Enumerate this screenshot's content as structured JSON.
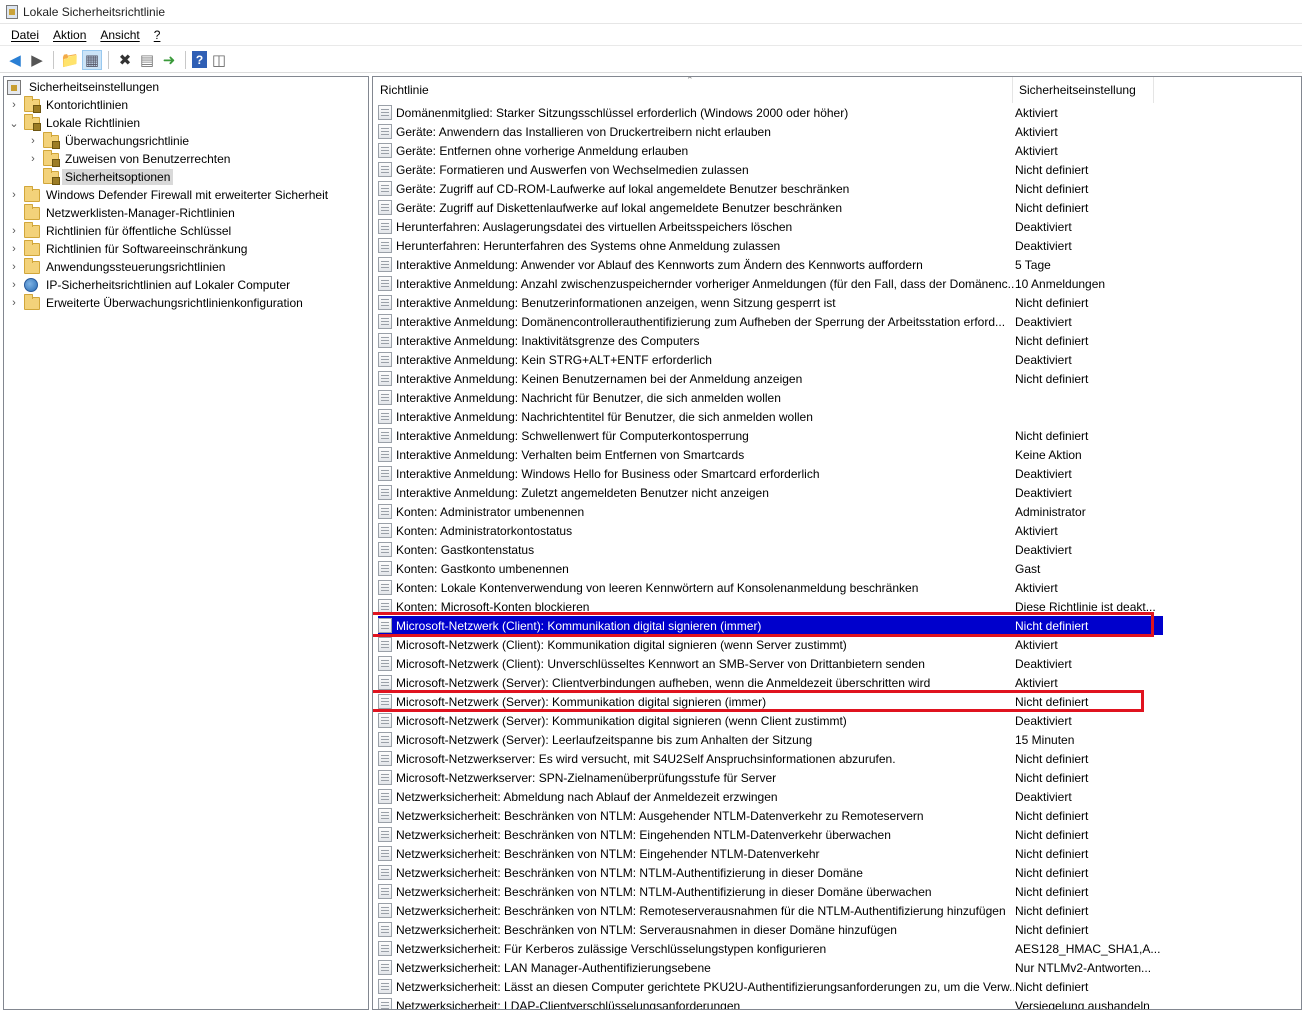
{
  "window": {
    "title": "Lokale Sicherheitsrichtlinie"
  },
  "menu": {
    "items": [
      "Datei",
      "Aktion",
      "Ansicht",
      "?"
    ]
  },
  "toolbar": {
    "buttons": [
      "back-arrow-icon",
      "forward-arrow-icon",
      "up-folder-icon",
      "show-hide-tree-icon",
      "delete-icon",
      "properties-icon",
      "export-list-icon",
      "help-icon",
      "action-pane-icon"
    ]
  },
  "tree": {
    "root": "Sicherheitseinstellungen",
    "items": [
      "Kontorichtlinien",
      "Lokale Richtlinien",
      "Überwachungsrichtlinie",
      "Zuweisen von Benutzerrechten",
      "Sicherheitsoptionen",
      "Windows Defender Firewall mit erweiterter Sicherheit",
      "Netzwerklisten-Manager-Richtlinien",
      "Richtlinien für öffentliche Schlüssel",
      "Richtlinien für Softwareeinschränkung",
      "Anwendungssteuerungsrichtlinien",
      "IP-Sicherheitsrichtlinien auf Lokaler Computer",
      "Erweiterte Überwachungsrichtlinienkonfiguration"
    ]
  },
  "list": {
    "columns": {
      "policy": "Richtlinie",
      "setting": "Sicherheitseinstellung"
    },
    "rows": [
      [
        "Domänenmitglied: Starker Sitzungsschlüssel erforderlich (Windows 2000 oder höher)",
        "Aktiviert"
      ],
      [
        "Geräte: Anwendern das Installieren von Druckertreibern nicht erlauben",
        "Aktiviert"
      ],
      [
        "Geräte: Entfernen ohne vorherige Anmeldung erlauben",
        "Aktiviert"
      ],
      [
        "Geräte: Formatieren und Auswerfen von Wechselmedien zulassen",
        "Nicht definiert"
      ],
      [
        "Geräte: Zugriff auf CD-ROM-Laufwerke auf lokal angemeldete Benutzer beschränken",
        "Nicht definiert"
      ],
      [
        "Geräte: Zugriff auf Diskettenlaufwerke auf lokal angemeldete Benutzer beschränken",
        "Nicht definiert"
      ],
      [
        "Herunterfahren: Auslagerungsdatei des virtuellen Arbeitsspeichers löschen",
        "Deaktiviert"
      ],
      [
        "Herunterfahren: Herunterfahren des Systems ohne Anmeldung zulassen",
        "Deaktiviert"
      ],
      [
        "Interaktive Anmeldung: Anwender vor Ablauf des Kennworts zum Ändern des Kennworts auffordern",
        "5 Tage"
      ],
      [
        "Interaktive Anmeldung: Anzahl zwischenzuspeichernder vorheriger Anmeldungen (für den Fall, dass der Domänenc...",
        "10 Anmeldungen"
      ],
      [
        "Interaktive Anmeldung: Benutzerinformationen anzeigen, wenn Sitzung gesperrt ist",
        "Nicht definiert"
      ],
      [
        "Interaktive Anmeldung: Domänencontrollerauthentifizierung zum Aufheben der Sperrung der Arbeitsstation erford...",
        "Deaktiviert"
      ],
      [
        "Interaktive Anmeldung: Inaktivitätsgrenze des Computers",
        "Nicht definiert"
      ],
      [
        "Interaktive Anmeldung: Kein STRG+ALT+ENTF erforderlich",
        "Deaktiviert"
      ],
      [
        "Interaktive Anmeldung: Keinen Benutzernamen bei der Anmeldung anzeigen",
        "Nicht definiert"
      ],
      [
        "Interaktive Anmeldung: Nachricht für Benutzer, die sich anmelden wollen",
        ""
      ],
      [
        "Interaktive Anmeldung: Nachrichtentitel für Benutzer, die sich anmelden wollen",
        ""
      ],
      [
        "Interaktive Anmeldung: Schwellenwert für Computerkontosperrung",
        "Nicht definiert"
      ],
      [
        "Interaktive Anmeldung: Verhalten beim Entfernen von Smartcards",
        "Keine Aktion"
      ],
      [
        "Interaktive Anmeldung: Windows Hello for Business oder Smartcard erforderlich",
        "Deaktiviert"
      ],
      [
        "Interaktive Anmeldung: Zuletzt angemeldeten Benutzer nicht anzeigen",
        "Deaktiviert"
      ],
      [
        "Konten: Administrator umbenennen",
        "Administrator"
      ],
      [
        "Konten: Administratorkontostatus",
        "Aktiviert"
      ],
      [
        "Konten: Gastkontenstatus",
        "Deaktiviert"
      ],
      [
        "Konten: Gastkonto umbenennen",
        "Gast"
      ],
      [
        "Konten: Lokale Kontenverwendung von leeren Kennwörtern auf Konsolenanmeldung beschränken",
        "Aktiviert"
      ],
      [
        "Konten: Microsoft-Konten blockieren",
        "Diese Richtlinie ist deakt..."
      ],
      [
        "Microsoft-Netzwerk (Client): Kommunikation digital signieren (immer)",
        "Nicht definiert"
      ],
      [
        "Microsoft-Netzwerk (Client): Kommunikation digital signieren (wenn Server zustimmt)",
        "Aktiviert"
      ],
      [
        "Microsoft-Netzwerk (Client): Unverschlüsseltes Kennwort an SMB-Server von Drittanbietern senden",
        "Deaktiviert"
      ],
      [
        "Microsoft-Netzwerk (Server): Clientverbindungen aufheben, wenn die Anmeldezeit überschritten wird",
        "Aktiviert"
      ],
      [
        "Microsoft-Netzwerk (Server): Kommunikation digital signieren (immer)",
        "Nicht definiert"
      ],
      [
        "Microsoft-Netzwerk (Server): Kommunikation digital signieren (wenn Client zustimmt)",
        "Deaktiviert"
      ],
      [
        "Microsoft-Netzwerk (Server): Leerlaufzeitspanne bis zum Anhalten der Sitzung",
        "15 Minuten"
      ],
      [
        "Microsoft-Netzwerkserver: Es wird versucht, mit S4U2Self Anspruchsinformationen abzurufen.",
        "Nicht definiert"
      ],
      [
        "Microsoft-Netzwerkserver: SPN-Zielnamenüberprüfungsstufe für Server",
        "Nicht definiert"
      ],
      [
        "Netzwerksicherheit: Abmeldung nach Ablauf der Anmeldezeit erzwingen",
        "Deaktiviert"
      ],
      [
        "Netzwerksicherheit: Beschränken von NTLM: Ausgehender NTLM-Datenverkehr zu Remoteservern",
        "Nicht definiert"
      ],
      [
        "Netzwerksicherheit: Beschränken von NTLM: Eingehenden NTLM-Datenverkehr überwachen",
        "Nicht definiert"
      ],
      [
        "Netzwerksicherheit: Beschränken von NTLM: Eingehender NTLM-Datenverkehr",
        "Nicht definiert"
      ],
      [
        "Netzwerksicherheit: Beschränken von NTLM: NTLM-Authentifizierung in dieser Domäne",
        "Nicht definiert"
      ],
      [
        "Netzwerksicherheit: Beschränken von NTLM: NTLM-Authentifizierung in dieser Domäne überwachen",
        "Nicht definiert"
      ],
      [
        "Netzwerksicherheit: Beschränken von NTLM: Remoteserverausnahmen für die NTLM-Authentifizierung hinzufügen",
        "Nicht definiert"
      ],
      [
        "Netzwerksicherheit: Beschränken von NTLM: Serverausnahmen in dieser Domäne hinzufügen",
        "Nicht definiert"
      ],
      [
        "Netzwerksicherheit: Für Kerberos zulässige Verschlüsselungstypen konfigurieren",
        "AES128_HMAC_SHA1,A..."
      ],
      [
        "Netzwerksicherheit: LAN Manager-Authentifizierungsebene",
        "Nur NTLMv2-Antworten..."
      ],
      [
        "Netzwerksicherheit: Lässt an diesen Computer gerichtete PKU2U-Authentifizierungsanforderungen zu, um die Verw...",
        "Nicht definiert"
      ],
      [
        "Netzwerksicherheit: LDAP-Clientverschlüsselungsanforderungen",
        "Versiegelung aushandeln"
      ]
    ]
  }
}
